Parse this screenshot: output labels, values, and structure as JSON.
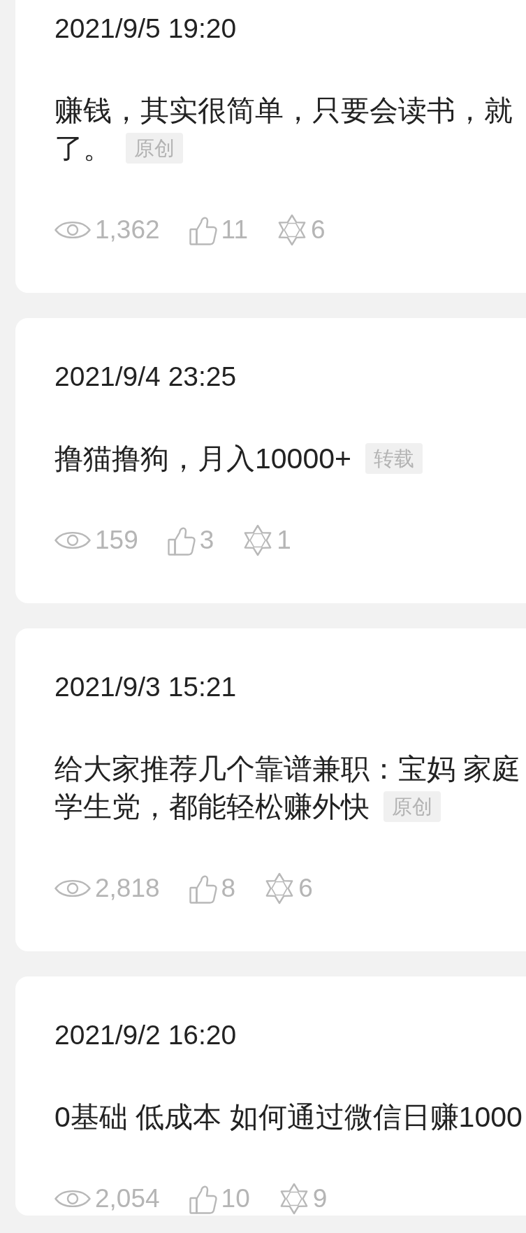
{
  "posts": [
    {
      "date": "2021/9/5 19:20",
      "title_lines": [
        "赚钱，其实很简单，只要会读书，就",
        "了。"
      ],
      "tag": "原创",
      "views": "1,362",
      "likes": "11",
      "star_count": "6"
    },
    {
      "date": "2021/9/4 23:25",
      "title_lines": [
        "撸猫撸狗，月入10000+"
      ],
      "tag": "转载",
      "views": "159",
      "likes": "3",
      "star_count": "1"
    },
    {
      "date": "2021/9/3 15:21",
      "title_lines": [
        "给大家推荐几个靠谱兼职：宝妈 家庭",
        "学生党，都能轻松赚外快"
      ],
      "tag": "原创",
      "views": "2,818",
      "likes": "8",
      "star_count": "6"
    },
    {
      "date": "2021/9/2 16:20",
      "title_lines": [
        "0基础 低成本 如何通过微信日赚1000"
      ],
      "views": "2,054",
      "likes": "10",
      "star_count": "9"
    }
  ]
}
